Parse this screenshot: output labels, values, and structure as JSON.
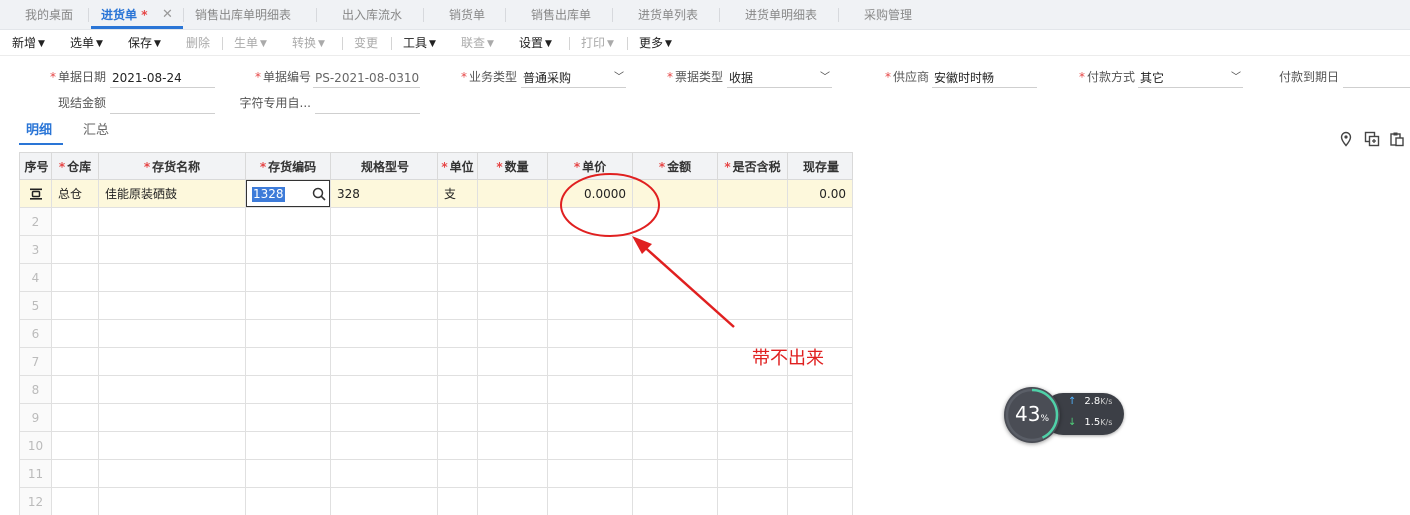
{
  "tabs": [
    {
      "label": "我的桌面"
    },
    {
      "label": "进货单",
      "dirty": "*"
    },
    {
      "label": "销售出库单明细表"
    },
    {
      "label": "出入库流水"
    },
    {
      "label": "销货单"
    },
    {
      "label": "销售出库单"
    },
    {
      "label": "进货单列表"
    },
    {
      "label": "进货单明细表"
    },
    {
      "label": "采购管理"
    }
  ],
  "toolbar": {
    "new": "新增",
    "select": "选单",
    "save": "保存",
    "delete": "删除",
    "generate": "生单",
    "convert": "转换",
    "change": "变更",
    "tools": "工具",
    "link": "联查",
    "settings": "设置",
    "print": "打印",
    "more": "更多"
  },
  "form": {
    "doc_date": {
      "label": "单据日期",
      "value": "2021-08-24"
    },
    "doc_no": {
      "label": "单据编号",
      "value": "PS-2021-08-0310"
    },
    "biz_type": {
      "label": "业务类型",
      "value": "普通采购"
    },
    "invoice_type": {
      "label": "票据类型",
      "value": "收据"
    },
    "supplier": {
      "label": "供应商",
      "value": "安徽时时畅"
    },
    "pay_method": {
      "label": "付款方式",
      "value": "其它"
    },
    "due_date": {
      "label": "付款到期日",
      "value": ""
    },
    "cash_amount": {
      "label": "现结金额",
      "value": ""
    },
    "custom_char": {
      "label": "字符专用自...",
      "value": ""
    }
  },
  "subtabs": {
    "detail": "明细",
    "summary": "汇总"
  },
  "grid": {
    "columns": [
      "序号",
      "仓库",
      "存货名称",
      "存货编码",
      "规格型号",
      "单位",
      "数量",
      "单价",
      "金额",
      "是否含税",
      "现存量"
    ],
    "required": [
      "",
      "*",
      "*",
      "*",
      "",
      "*",
      "*",
      "*",
      "*",
      "*",
      ""
    ],
    "first_row": {
      "warehouse": "总仓",
      "name": "佳能原装硒鼓",
      "code": "1328",
      "spec": "328",
      "unit": "支",
      "qty": "",
      "price": "0.0000",
      "amount": "",
      "tax_incl": "",
      "stock": "0.00"
    },
    "row_numbers": [
      "2",
      "3",
      "4",
      "5",
      "6",
      "7",
      "8",
      "9",
      "10",
      "11",
      "12"
    ]
  },
  "annotation": {
    "note": "带不出来",
    "color": "#e02020"
  },
  "network_widget": {
    "percent": "43",
    "percent_unit": "%",
    "upload": "2.8",
    "download": "1.5",
    "rate_unit": "K/s"
  }
}
